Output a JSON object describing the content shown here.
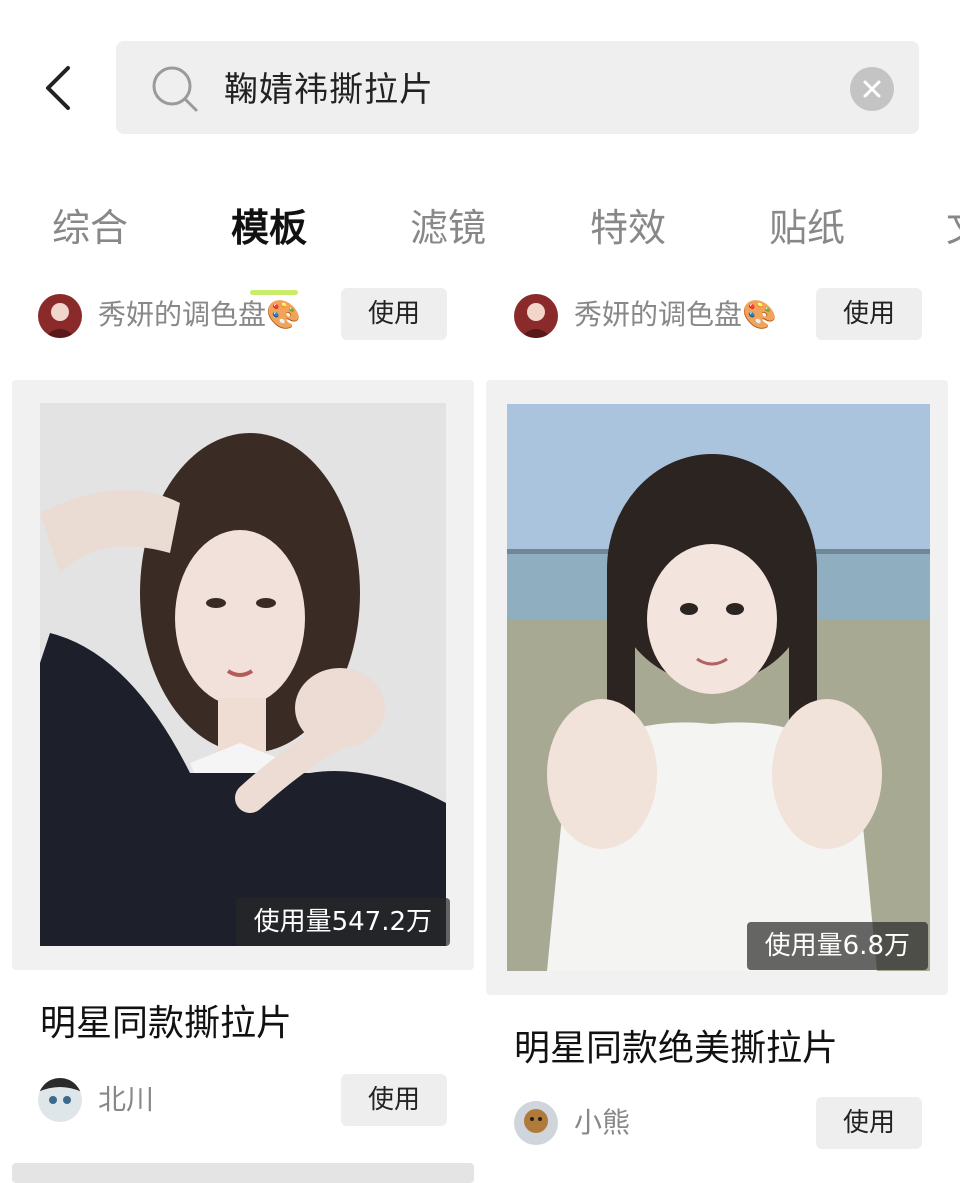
{
  "search": {
    "query": "鞠婧祎撕拉片"
  },
  "tabs": [
    {
      "label": "综合"
    },
    {
      "label": "模板"
    },
    {
      "label": "滤镜"
    },
    {
      "label": "特效"
    },
    {
      "label": "贴纸"
    },
    {
      "label": "文"
    }
  ],
  "active_tab": "模板",
  "top_row": [
    {
      "author": "秀妍的调色盘🎨",
      "use_label": "使用"
    },
    {
      "author": "秀妍的调色盘🎨",
      "use_label": "使用"
    }
  ],
  "cards": [
    {
      "usage": "使用量547.2万",
      "title": "明星同款撕拉片",
      "author": "北川",
      "use_label": "使用"
    },
    {
      "usage": "使用量6.8万",
      "title": "明星同款绝美撕拉片",
      "author": "小熊",
      "use_label": "使用"
    }
  ],
  "colors": {
    "tab_active_underline": "#c9ed6b",
    "search_bg": "#efefef",
    "button_bg": "#eeeeee"
  }
}
